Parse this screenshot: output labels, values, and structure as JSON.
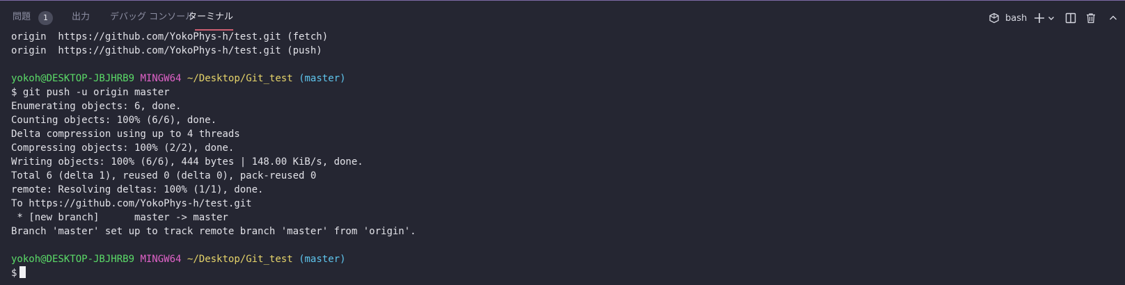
{
  "panel": {
    "tabs": [
      {
        "label": "問題",
        "badge": "1"
      },
      {
        "label": "出力"
      },
      {
        "label": "デバッグ コンソール"
      },
      {
        "label": "ターミナル",
        "active": true
      }
    ],
    "shell_label": "bash",
    "icons": [
      "terminal-icon",
      "plus-icon",
      "chevron-down-icon",
      "split-icon",
      "trash-icon",
      "chevron-up-icon"
    ]
  },
  "terminal": {
    "lines": [
      {
        "type": "text",
        "text": "origin  https://github.com/YokoPhys-h/test.git (fetch)"
      },
      {
        "type": "text",
        "text": "origin  https://github.com/YokoPhys-h/test.git (push)"
      },
      {
        "type": "blank"
      },
      {
        "type": "prompt",
        "user": "yokoh@DESKTOP-JBJHRB9",
        "system": "MINGW64",
        "path": "~/Desktop/Git_test",
        "branch": "(master)"
      },
      {
        "type": "text",
        "text": "$ git push -u origin master"
      },
      {
        "type": "text",
        "text": "Enumerating objects: 6, done."
      },
      {
        "type": "text",
        "text": "Counting objects: 100% (6/6), done."
      },
      {
        "type": "text",
        "text": "Delta compression using up to 4 threads"
      },
      {
        "type": "text",
        "text": "Compressing objects: 100% (2/2), done."
      },
      {
        "type": "text",
        "text": "Writing objects: 100% (6/6), 444 bytes | 148.00 KiB/s, done."
      },
      {
        "type": "text",
        "text": "Total 6 (delta 1), reused 0 (delta 0), pack-reused 0"
      },
      {
        "type": "text",
        "text": "remote: Resolving deltas: 100% (1/1), done."
      },
      {
        "type": "text",
        "text": "To https://github.com/YokoPhys-h/test.git"
      },
      {
        "type": "text",
        "text": " * [new branch]      master -> master"
      },
      {
        "type": "text",
        "text": "Branch 'master' set up to track remote branch 'master' from 'origin'."
      },
      {
        "type": "blank"
      },
      {
        "type": "prompt",
        "user": "yokoh@DESKTOP-JBJHRB9",
        "system": "MINGW64",
        "path": "~/Desktop/Git_test",
        "branch": "(master)"
      },
      {
        "type": "input",
        "text": "$"
      }
    ]
  },
  "colors": {
    "background": "#252632",
    "user": "#5bdb68",
    "system": "#e062c8",
    "path": "#e6d46a",
    "branch": "#5fc6ee",
    "tab_underline": "#cf5f72"
  }
}
